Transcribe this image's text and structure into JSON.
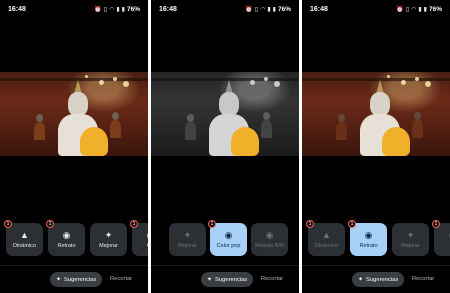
{
  "status_bar": {
    "time": "16:48",
    "battery": "76%"
  },
  "screens": [
    {
      "tools": [
        {
          "label": "Dinámico",
          "icon": "mountain-icon",
          "badge": "1",
          "state": "normal"
        },
        {
          "label": "Retrato",
          "icon": "person-icon",
          "badge": "1",
          "state": "normal"
        },
        {
          "label": "Mejorar",
          "icon": "sparkle-icon",
          "badge": "",
          "state": "normal"
        },
        {
          "label": "Co",
          "icon": "person-icon",
          "badge": "1",
          "state": "normal"
        }
      ]
    },
    {
      "tools": [
        {
          "label": "Mejorar",
          "icon": "sparkle-icon",
          "badge": "",
          "state": "dim"
        },
        {
          "label": "Color pop",
          "icon": "person-icon",
          "badge": "1",
          "state": "active"
        },
        {
          "label": "Retrato B/N",
          "icon": "person-icon",
          "badge": "",
          "state": "dim"
        }
      ]
    },
    {
      "tools": [
        {
          "label": "Dinámico",
          "icon": "mountain-icon",
          "badge": "1",
          "state": "dim"
        },
        {
          "label": "Retrato",
          "icon": "person-icon",
          "badge": "1",
          "state": "active"
        },
        {
          "label": "Mejorar",
          "icon": "sparkle-icon",
          "badge": "",
          "state": "dim"
        },
        {
          "label": "C",
          "icon": "person-icon",
          "badge": "1",
          "state": "dim"
        }
      ]
    }
  ],
  "bottom": {
    "suggestions_label": "Sugerencias",
    "crop_label": "Recortar"
  }
}
